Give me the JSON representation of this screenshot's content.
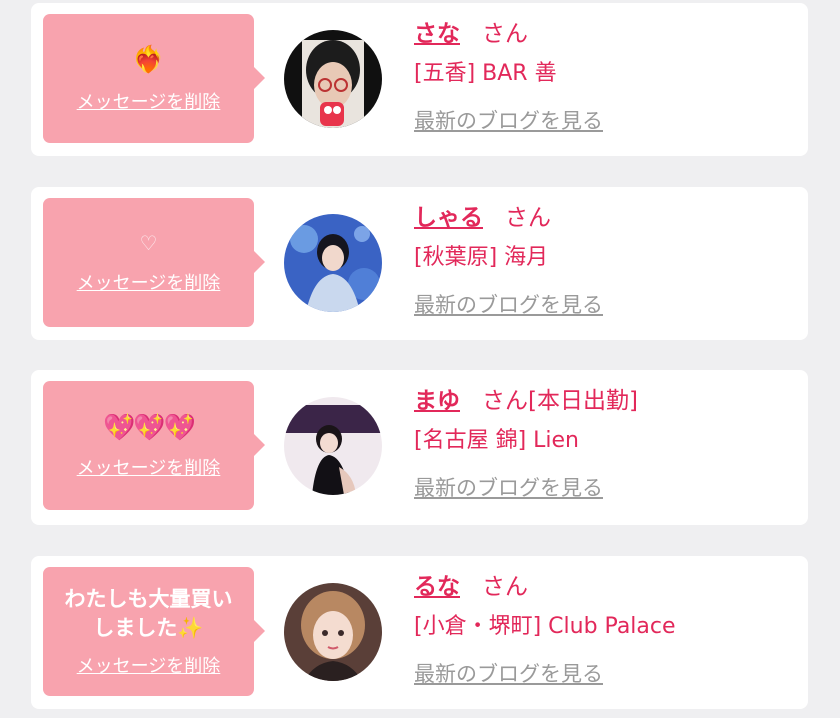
{
  "cards": [
    {
      "message": "❤️‍🔥",
      "delete_label": "メッセージを削除",
      "name": "さな",
      "honorific": "さん",
      "status": "",
      "shop": "[五香] BAR 善",
      "blog_link": "最新のブログを見る"
    },
    {
      "message": "♡",
      "delete_label": "メッセージを削除",
      "name": "しゃる",
      "honorific": "さん",
      "status": "",
      "shop": "[秋葉原] 海月",
      "blog_link": "最新のブログを見る"
    },
    {
      "message": "💖💖💖",
      "delete_label": "メッセージを削除",
      "name": "まゆ",
      "honorific": "さん",
      "status": "[本日出勤]",
      "shop": "[名古屋 錦] Lien",
      "blog_link": "最新のブログを見る"
    },
    {
      "message": "わたしも大量買いしました✨",
      "delete_label": "メッセージを削除",
      "name": "るな",
      "honorific": "さん",
      "status": "",
      "shop": "[小倉・堺町] Club Palace",
      "blog_link": "最新のブログを見る"
    }
  ],
  "colors": {
    "bubble": "#f8a3ae",
    "accent": "#e2285a",
    "link_gray": "#9a9a9a",
    "background": "#efeff1"
  }
}
